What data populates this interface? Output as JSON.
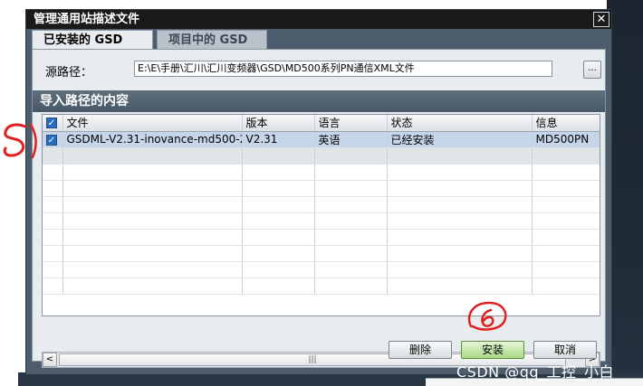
{
  "dialog": {
    "title": "管理通用站描述文件",
    "close_label": "✕"
  },
  "tabs": [
    {
      "label": "已安装的 GSD"
    },
    {
      "label": "项目中的 GSD"
    }
  ],
  "source": {
    "label": "源路径：",
    "value": "E:\\E\\手册\\汇川\\汇川变频器\\GSD\\MD500系列PN通信XML文件",
    "browse_label": "..."
  },
  "section_title": "导入路径的内容",
  "table": {
    "headers": [
      "文件",
      "版本",
      "语言",
      "状态",
      "信息"
    ],
    "rows": [
      {
        "checked": true,
        "file": "GSDML-V2.31-inovance-md500-2...",
        "version": "V2.31",
        "language": "英语",
        "status": "已经安装",
        "info": "MD500PN"
      }
    ]
  },
  "scrollbar": {
    "left": "<",
    "thumb": "|||",
    "right": ">"
  },
  "buttons": {
    "delete": "删除",
    "install": "安装",
    "cancel": "取消"
  },
  "annotations": {
    "step5": "5",
    "step6": "6"
  },
  "watermark": "CSDN @qq_工控_小白",
  "colors": {
    "selected_row": "#c6d6ea",
    "install_button": "#a9d987",
    "annotation": "#e02020"
  }
}
